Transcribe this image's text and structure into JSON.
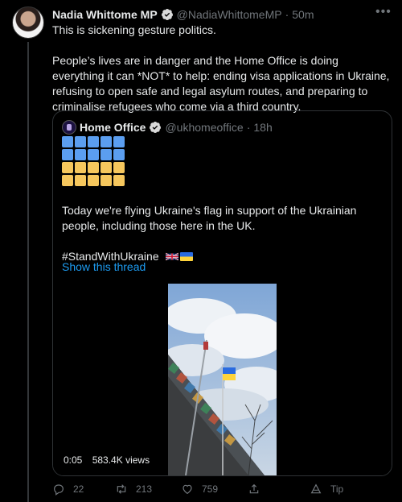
{
  "author": {
    "name": "Nadia Whittome MP",
    "handle": "@NadiaWhittomeMP",
    "separator": "·",
    "time": "50m"
  },
  "more_icon": "ellipsis-icon",
  "tweet_text": {
    "line1": "This is sickening gesture politics.",
    "line2": "People’s lives are in danger and the Home Office is doing everything it can *NOT* to help: ending visa applications in Ukraine, refusing to open safe and legal asylum routes, and preparing to criminalise refugees who come via a third country."
  },
  "quoted": {
    "name": "Home Office",
    "handle": "@ukhomeoffice",
    "separator": "·",
    "time": "18h",
    "text1": "Today we're flying Ukraine's flag in support of the Ukrainian people, including those here in the UK.",
    "hashtag": "#StandWithUkraine",
    "show_thread": "Show this thread",
    "emoji_rows": {
      "blue_rows": 2,
      "yellow_rows": 2,
      "columns": 5,
      "blue": "#5b9ef0",
      "yellow": "#f6c75d"
    },
    "video": {
      "time": "0:05",
      "views": "583.4K views"
    }
  },
  "actions": {
    "reply_count": "22",
    "retweet_count": "213",
    "like_count": "759",
    "tip_label": "Tip"
  },
  "colors": {
    "background": "#000000",
    "verified": "#d9d9d9",
    "link": "#1d9bf0",
    "muted": "#71767b"
  }
}
